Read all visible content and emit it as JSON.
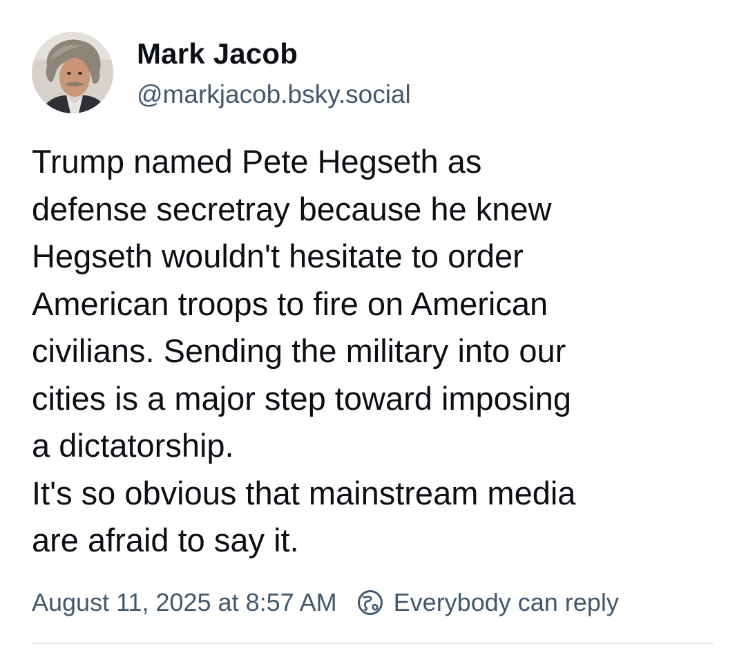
{
  "post": {
    "author": {
      "name": "Mark Jacob",
      "handle": "@markjacob.bsky.social",
      "avatar_icon": "user-avatar-photo"
    },
    "text": "Trump named Pete Hegseth as\ndefense secretray because he knew\nHegseth wouldn't hesitate to order\nAmerican troops to fire on American\ncivilians. Sending the military into our\ncities is a major step toward imposing\na dictatorship.\nIt's so obvious that mainstream media\nare afraid to say it.",
    "timestamp": "August 11, 2025 at 8:57 AM",
    "reply_setting": {
      "icon": "globe-icon",
      "label": "Everybody can reply"
    }
  },
  "colors": {
    "text_primary": "#0b0f14",
    "text_secondary": "#42576c",
    "divider": "#e6eaee",
    "background": "#ffffff"
  }
}
